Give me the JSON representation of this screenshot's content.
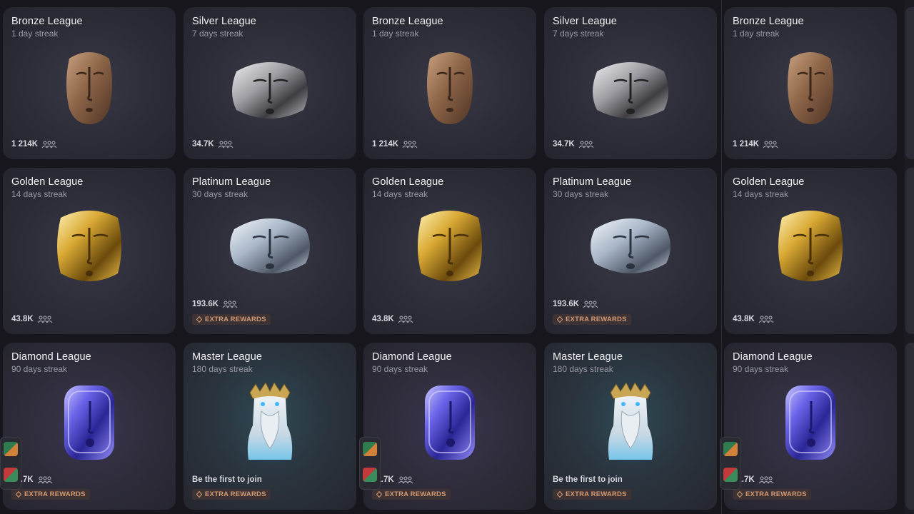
{
  "leagues": {
    "bronze": {
      "title": "Bronze League",
      "streak": "1 day streak",
      "members": "1 214K"
    },
    "silver": {
      "title": "Silver League",
      "streak": "7 days streak",
      "members": "34.7K"
    },
    "golden": {
      "title": "Golden League",
      "streak": "14 days streak",
      "members": "43.8K"
    },
    "platinum": {
      "title": "Platinum League",
      "streak": "30 days streak",
      "members": "193.6K",
      "badge": "EXTRA REWARDS"
    },
    "diamond": {
      "title": "Diamond League",
      "streak": "90 days streak",
      "members": "172.7K",
      "members_visible": "72.7K",
      "badge": "EXTRA REWARDS"
    },
    "master": {
      "title": "Master League",
      "streak": "180 days streak",
      "members": "Be the first to join",
      "badge": "EXTRA REWARDS"
    }
  },
  "icons": {
    "members": "group-icon",
    "badge": "diamond-outline-icon",
    "mask": "face-mask-icon",
    "master": "crowned-bust-icon"
  },
  "colors": {
    "bronze": "#8a6447",
    "silver": "#b9b9bd",
    "gold": "#c79a2b",
    "platinum": "#aab9cc",
    "diamond": "#5a55d6",
    "badge_text": "#d59a73"
  }
}
